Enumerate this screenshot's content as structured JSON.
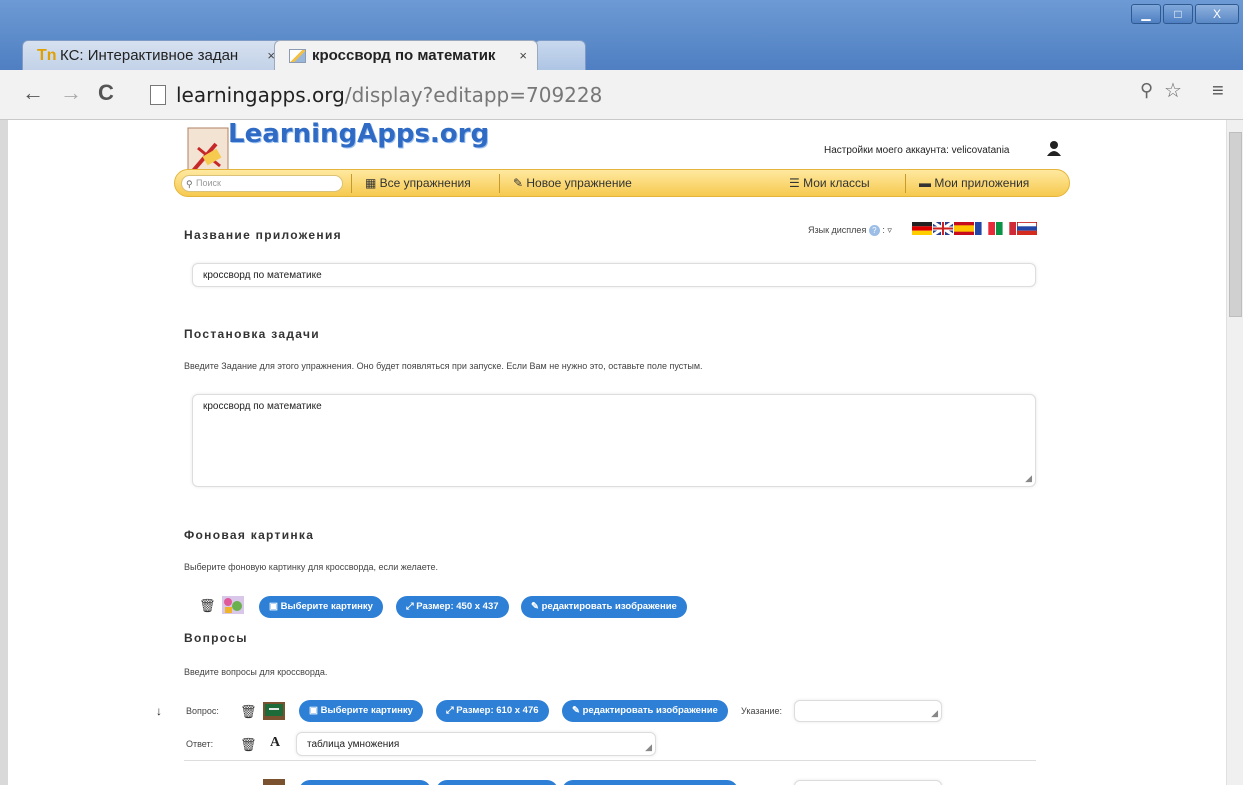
{
  "browser": {
    "tabs": [
      {
        "title": "КС: Интерактивное задан",
        "close": "×"
      },
      {
        "title": "кроссворд по математик",
        "close": "×"
      }
    ],
    "url_domain": "learningapps.org",
    "url_path": "/display?editapp=709228",
    "window_controls": {
      "minimize": "▁",
      "maximize": "□",
      "close": "X"
    }
  },
  "header": {
    "logo": "LearningApps.org",
    "account": "Настройки моего аккаунта: velicovatania"
  },
  "navbar": {
    "search_placeholder": "Поиск",
    "items": [
      "Все упражнения",
      "Новое упражнение",
      "Мои классы",
      "Мои приложения"
    ]
  },
  "app_name": {
    "title": "Название приложения",
    "value": "кроссворд по математике",
    "language_label": "Язык дисплея",
    "help": "?"
  },
  "task": {
    "title": "Постановка задачи",
    "hint": "Введите Задание для этого упражнения. Оно будет появляться при запуске. Если Вам не нужно это, оставьте поле пустым.",
    "value": "кроссворд по математике"
  },
  "background": {
    "title": "Фоновая картинка",
    "hint": "Выберите фоновую картинку для кроссворда, если желаете.",
    "buttons": [
      "Выберите картинку",
      "Размер: 450 x 437",
      "редактировать изображение"
    ]
  },
  "questions": {
    "title": "Вопросы",
    "hint": "Введите вопросы для кроссворда.",
    "question_label": "Вопрос:",
    "answer_label": "Ответ:",
    "buttons": [
      "Выберите картинку",
      "Размер: 610 x 476",
      "редактировать изображение"
    ],
    "hint_label": "Указание:",
    "answer_value": "таблица умножения",
    "text_mode": "A"
  },
  "colors": {
    "accent": "#2e7fd6",
    "navbar": "#f6c94f",
    "logo": "#2f6bc4"
  }
}
